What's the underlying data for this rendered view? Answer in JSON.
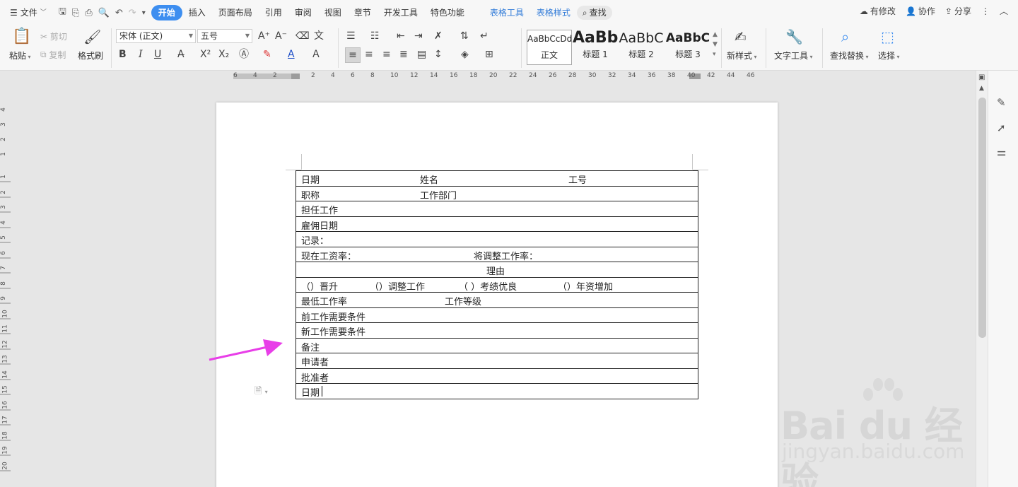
{
  "menubar": {
    "file_label": "文件",
    "tabs": [
      {
        "label": "开始",
        "active": true
      },
      {
        "label": "插入"
      },
      {
        "label": "页面布局"
      },
      {
        "label": "引用"
      },
      {
        "label": "审阅"
      },
      {
        "label": "视图"
      },
      {
        "label": "章节"
      },
      {
        "label": "开发工具"
      },
      {
        "label": "特色功能"
      }
    ],
    "context_tabs": [
      "表格工具",
      "表格样式"
    ],
    "search_label": "查找",
    "right": {
      "changes": "有修改",
      "collab": "协作",
      "share": "分享"
    }
  },
  "ribbon": {
    "paste": "粘贴",
    "cut": "剪切",
    "copy": "复制",
    "format_painter": "格式刷",
    "font_name": "宋体 (正文)",
    "font_size": "五号",
    "bold": "B",
    "italic": "I",
    "underline": "U",
    "styles": [
      {
        "sample": "AaBbCcDd",
        "name": "正文"
      },
      {
        "sample": "AaBb",
        "name": "标题 1"
      },
      {
        "sample": "AaBbC",
        "name": "标题 2"
      },
      {
        "sample": "AaBbC",
        "name": "标题 3"
      }
    ],
    "new_style": "新样式",
    "text_tools": "文字工具",
    "find_replace": "查找替换",
    "select": "选择",
    "accent": "#3d8ef0"
  },
  "ruler": {
    "h_numbers": [
      "6",
      "4",
      "2",
      "2",
      "4",
      "6",
      "8",
      "10",
      "12",
      "14",
      "16",
      "18",
      "20",
      "22",
      "24",
      "26",
      "28",
      "30",
      "32",
      "34",
      "36",
      "38",
      "40",
      "42",
      "44",
      "46"
    ],
    "v_numbers": [
      "4",
      "3",
      "2",
      "1",
      "1",
      "2",
      "3",
      "4",
      "5",
      "6",
      "7",
      "8",
      "9",
      "10",
      "11",
      "12",
      "13",
      "14",
      "15",
      "16",
      "17",
      "18",
      "19",
      "20"
    ]
  },
  "table": {
    "rows": [
      [
        "日期",
        "姓名",
        "工号"
      ],
      [
        "职称",
        "工作部门"
      ],
      [
        "担任工作"
      ],
      [
        "雇佣日期"
      ],
      [
        "记录："
      ],
      [
        "现在工资率：",
        "将调整工作率："
      ],
      [
        "理由"
      ],
      [
        "（）晋升",
        "（）调整工作",
        "（ ）考绩优良",
        "（）年资增加"
      ],
      [
        "最低工作率",
        "工作等级"
      ],
      [
        "前工作需要条件"
      ],
      [
        "新工作需要条件"
      ],
      [
        "备注"
      ],
      [
        "申请者"
      ],
      [
        "批准者"
      ],
      [
        "日期"
      ]
    ]
  },
  "annotation": {
    "arrow_color": "#e83ee8"
  },
  "watermark": {
    "logo": "Bai du 经验",
    "url": "jingyan.baidu.com"
  }
}
